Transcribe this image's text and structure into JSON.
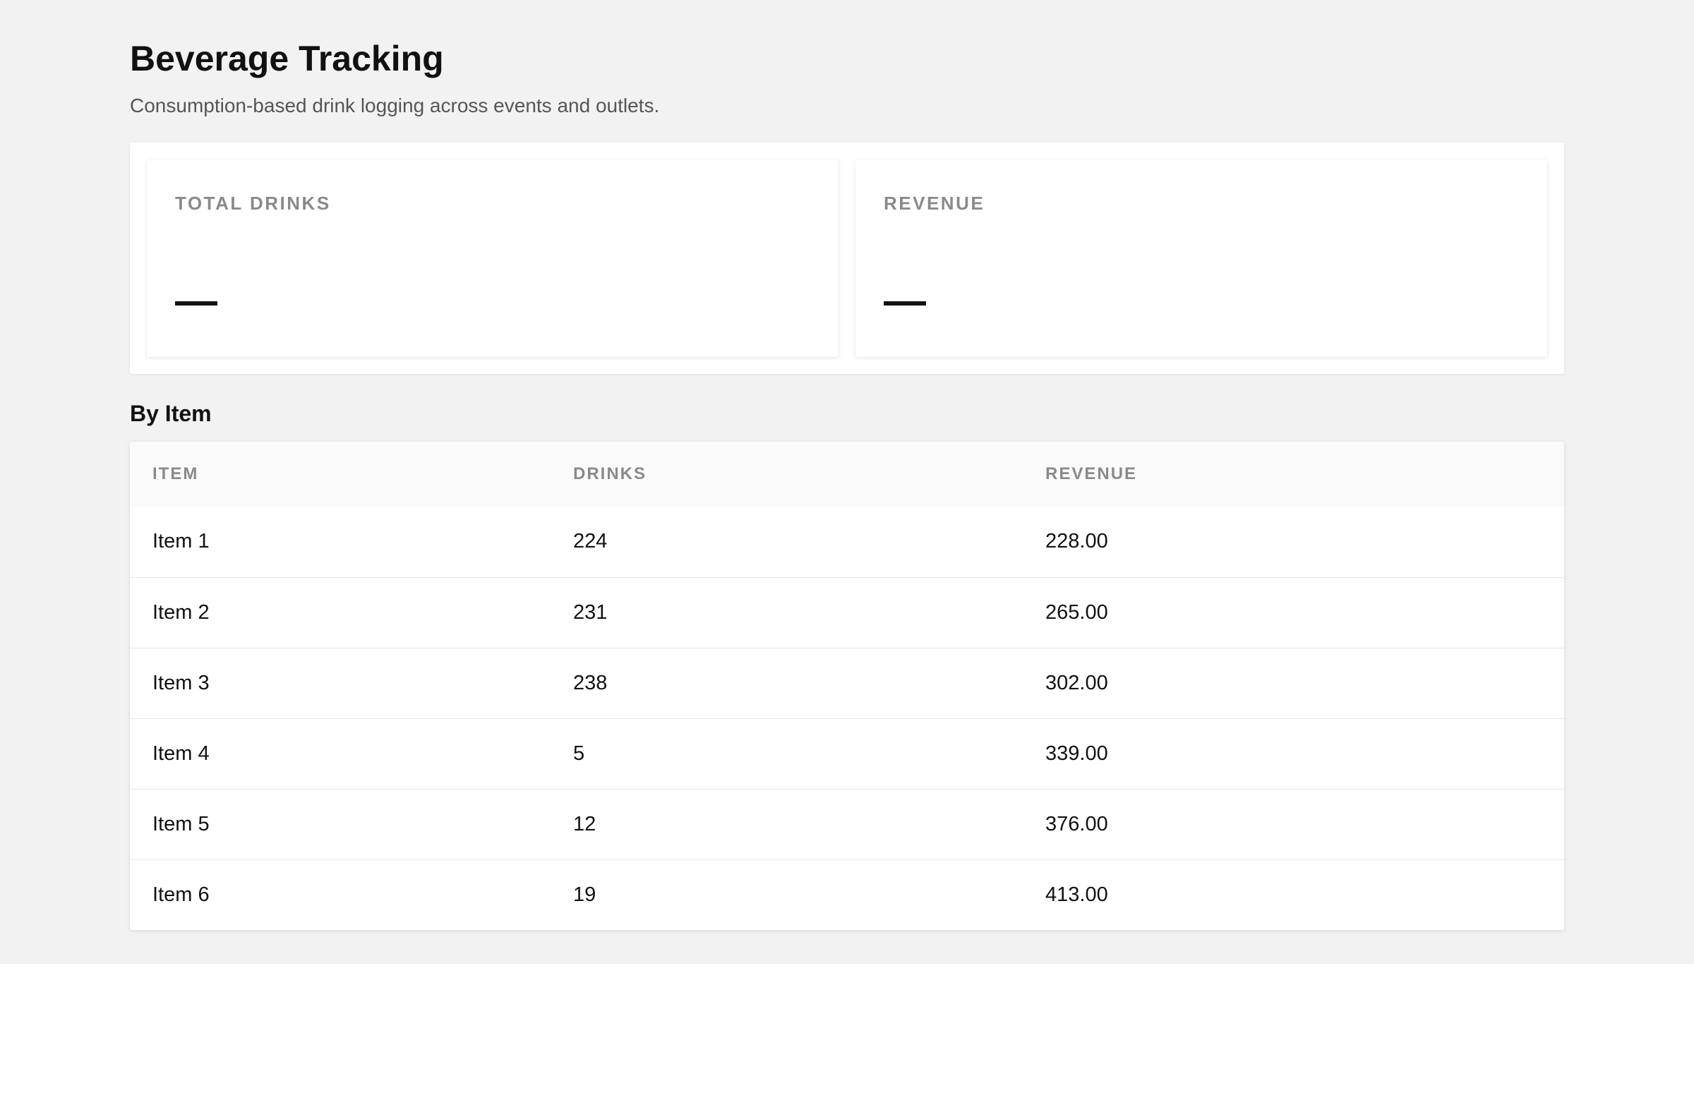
{
  "header": {
    "title": "Beverage Tracking",
    "subtitle": "Consumption-based drink logging across events and outlets."
  },
  "stats": [
    {
      "label": "TOTAL DRINKS",
      "value": "—"
    },
    {
      "label": "REVENUE",
      "value": "—"
    }
  ],
  "by_item": {
    "title": "By Item",
    "columns": [
      "ITEM",
      "DRINKS",
      "REVENUE"
    ],
    "rows": [
      {
        "item": "Item 1",
        "drinks": "224",
        "revenue": "228.00"
      },
      {
        "item": "Item 2",
        "drinks": "231",
        "revenue": "265.00"
      },
      {
        "item": "Item 3",
        "drinks": "238",
        "revenue": "302.00"
      },
      {
        "item": "Item 4",
        "drinks": "5",
        "revenue": "339.00"
      },
      {
        "item": "Item 5",
        "drinks": "12",
        "revenue": "376.00"
      },
      {
        "item": "Item 6",
        "drinks": "19",
        "revenue": "413.00"
      }
    ]
  },
  "colors": {
    "page_background": "#f2f2f2",
    "card_background": "#ffffff",
    "muted_text": "#8a8a8a",
    "primary_text": "#111111"
  }
}
